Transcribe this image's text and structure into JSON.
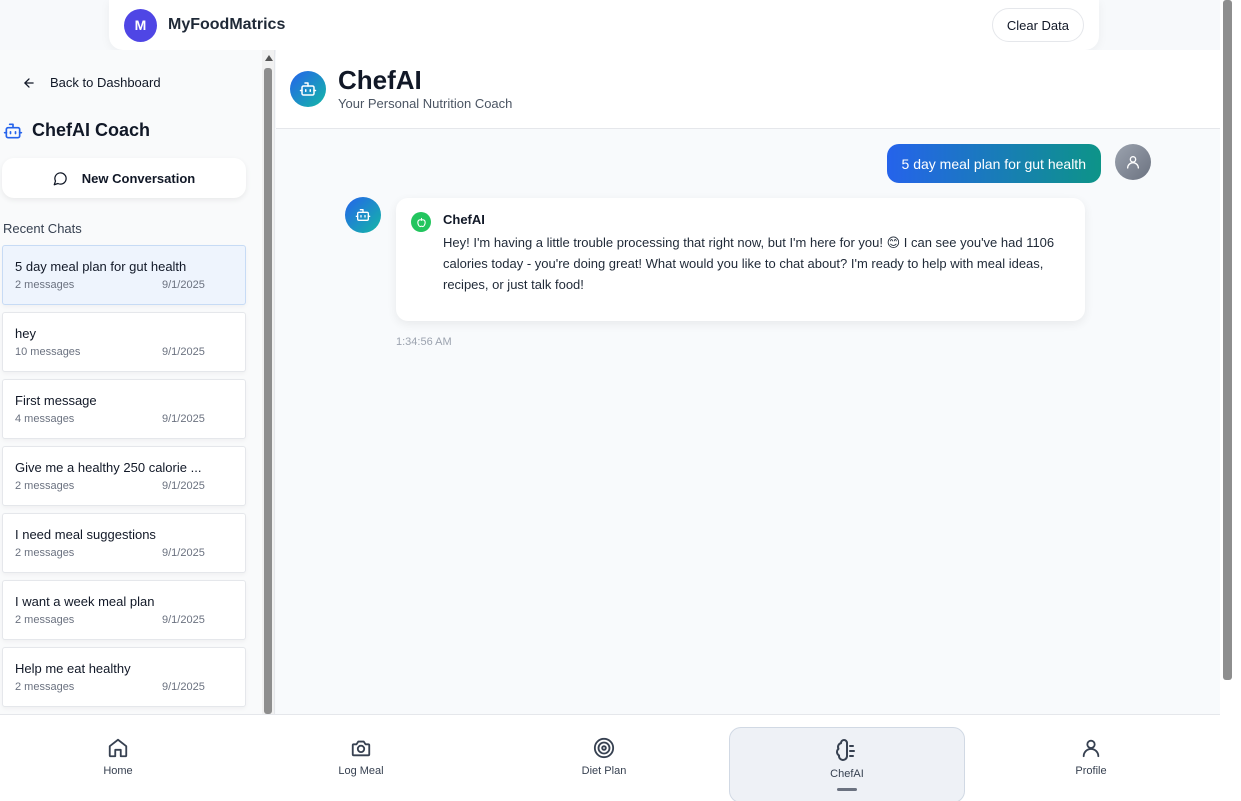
{
  "header": {
    "avatar_letter": "M",
    "brand": "MyFoodMatrics",
    "clear_button": "Clear Data"
  },
  "sidebar": {
    "back_label": "Back to Dashboard",
    "title": "ChefAI Coach",
    "new_conversation": "New Conversation",
    "recent_label": "Recent Chats",
    "chats": [
      {
        "title": "5 day meal plan for gut health",
        "count": "2 messages",
        "date": "9/1/2025"
      },
      {
        "title": "hey",
        "count": "10 messages",
        "date": "9/1/2025"
      },
      {
        "title": "First message",
        "count": "4 messages",
        "date": "9/1/2025"
      },
      {
        "title": "Give me a healthy 250 calorie ...",
        "count": "2 messages",
        "date": "9/1/2025"
      },
      {
        "title": "I need meal suggestions",
        "count": "2 messages",
        "date": "9/1/2025"
      },
      {
        "title": "I want a week meal plan",
        "count": "2 messages",
        "date": "9/1/2025"
      },
      {
        "title": "Help me eat healthy",
        "count": "2 messages",
        "date": "9/1/2025"
      }
    ]
  },
  "main": {
    "title": "ChefAI",
    "subtitle": "Your Personal Nutrition Coach",
    "user_message": "5 day meal plan for gut health",
    "bot_name": "ChefAI",
    "bot_message": "Hey! I'm having a little trouble processing that right now, but I'm here for you! 😊 I can see you've had 1106 calories today - you're doing great! What would you like to chat about? I'm ready to help with meal ideas, recipes, or just talk food!",
    "timestamp": "1:34:56 AM"
  },
  "nav": {
    "items": [
      {
        "label": "Home",
        "icon": "home-icon"
      },
      {
        "label": "Log Meal",
        "icon": "camera-icon"
      },
      {
        "label": "Diet Plan",
        "icon": "target-icon"
      },
      {
        "label": "ChefAI",
        "icon": "brain-icon"
      },
      {
        "label": "Profile",
        "icon": "user-icon"
      }
    ],
    "active": "ChefAI"
  },
  "colors": {
    "brand_avatar": "#4f46e5",
    "accent_gradient_start": "#2563eb",
    "accent_gradient_end": "#0d9488",
    "apple_green": "#22c55e"
  }
}
